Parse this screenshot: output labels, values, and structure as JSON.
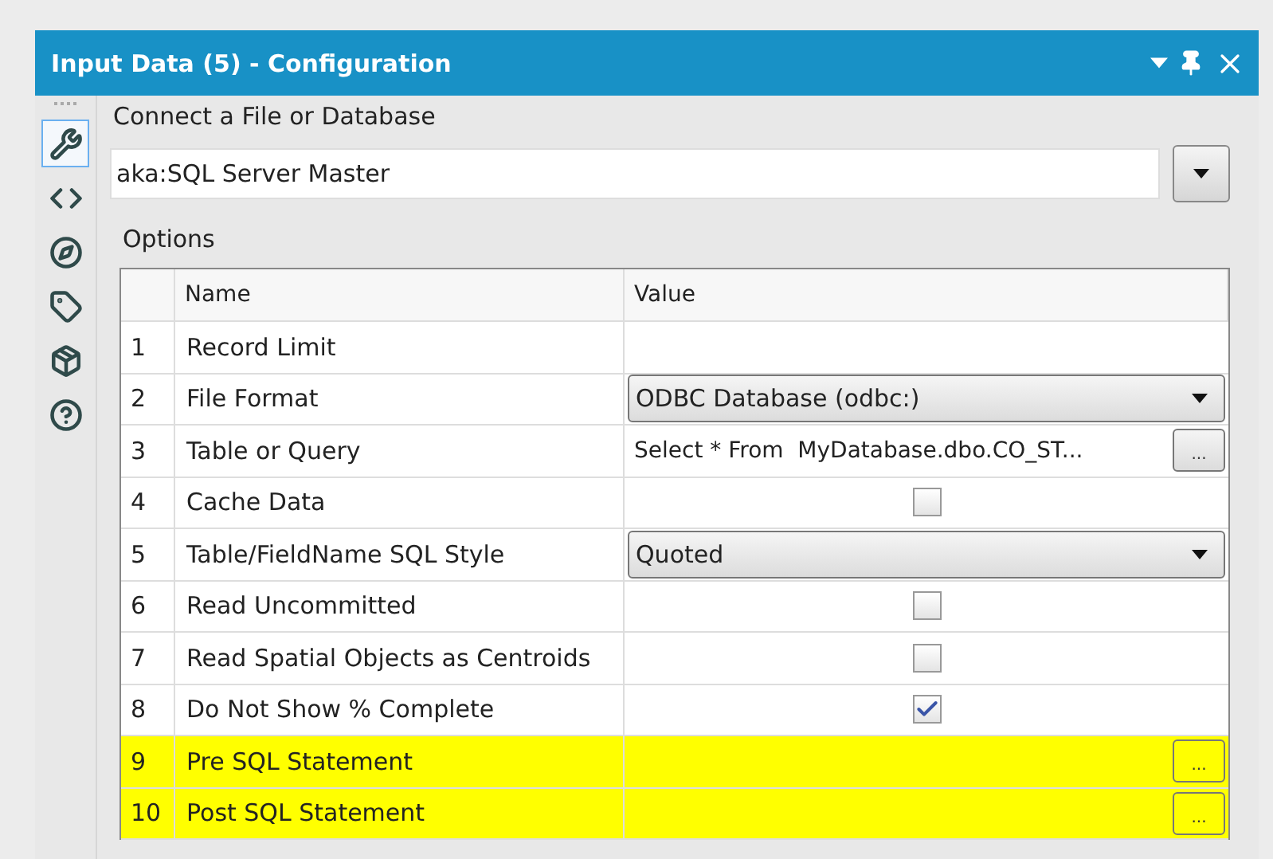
{
  "window": {
    "title": "Input Data (5) - Configuration"
  },
  "sidebar": {
    "items": [
      {
        "kind": "wrench",
        "selected": true
      },
      {
        "kind": "code",
        "selected": false
      },
      {
        "kind": "compass",
        "selected": false
      },
      {
        "kind": "tag",
        "selected": false
      },
      {
        "kind": "box",
        "selected": false
      },
      {
        "kind": "help",
        "selected": false
      }
    ]
  },
  "connection": {
    "label": "Connect a File or Database",
    "value": "aka:SQL Server Master"
  },
  "options": {
    "label": "Options",
    "columns": [
      "Name",
      "Value"
    ],
    "rows": [
      {
        "number": "1",
        "name": "Record Limit",
        "kind": "text",
        "value": "",
        "highlighted": false
      },
      {
        "number": "2",
        "name": "File Format",
        "kind": "dropdown",
        "value": "ODBC Database (odbc:)",
        "highlighted": false
      },
      {
        "number": "3",
        "name": "Table or Query",
        "kind": "button",
        "value": "Select * From  MyDatabase.dbo.CO_ST...",
        "button": "...",
        "highlighted": false
      },
      {
        "number": "4",
        "name": "Cache Data",
        "kind": "checkbox",
        "checked": false,
        "highlighted": false
      },
      {
        "number": "5",
        "name": "Table/FieldName SQL Style",
        "kind": "dropdown",
        "value": "Quoted",
        "highlighted": false
      },
      {
        "number": "6",
        "name": "Read Uncommitted",
        "kind": "checkbox",
        "checked": false,
        "highlighted": false
      },
      {
        "number": "7",
        "name": "Read Spatial Objects as Centroids",
        "kind": "checkbox",
        "checked": false,
        "highlighted": false
      },
      {
        "number": "8",
        "name": "Do Not Show % Complete",
        "kind": "checkbox",
        "checked": true,
        "highlighted": false
      },
      {
        "number": "9",
        "name": "Pre SQL Statement",
        "kind": "button",
        "value": "",
        "button": "...",
        "highlighted": true
      },
      {
        "number": "10",
        "name": "Post SQL Statement",
        "kind": "button",
        "value": "",
        "button": "...",
        "highlighted": true
      }
    ]
  }
}
